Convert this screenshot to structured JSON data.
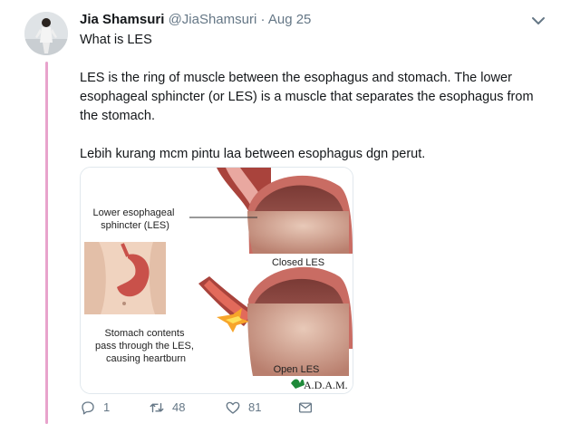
{
  "tweet": {
    "author_name": "Jia Shamsuri",
    "handle": "@JiaShamsuri",
    "separator": "·",
    "timestamp": "Aug 25",
    "paragraph_1": "What is LES",
    "paragraph_2": "LES is the ring of muscle between the esophagus and stomach. The lower esophageal sphincter (or LES) is a muscle that separates the esophagus from the stomach.",
    "paragraph_3": "Lebih kurang mcm pintu laa between esophagus dgn perut."
  },
  "media": {
    "label_les": [
      "Lower esophageal",
      "sphincter (LES)"
    ],
    "label_closed": "Closed LES",
    "label_contents": [
      "Stomach contents",
      "pass through the LES,",
      "causing heartburn"
    ],
    "label_open": "Open LES",
    "logo_text": "A.D.A.M."
  },
  "actions": {
    "reply_count": "1",
    "retweet_count": "48",
    "like_count": "81"
  },
  "colors": {
    "thread_line": "#e8a3cc",
    "secondary_text": "#657786",
    "primary_text": "#14171a"
  },
  "icons": [
    "avatar",
    "chevron-down-icon",
    "reply-icon",
    "retweet-icon",
    "like-icon",
    "message-icon"
  ]
}
